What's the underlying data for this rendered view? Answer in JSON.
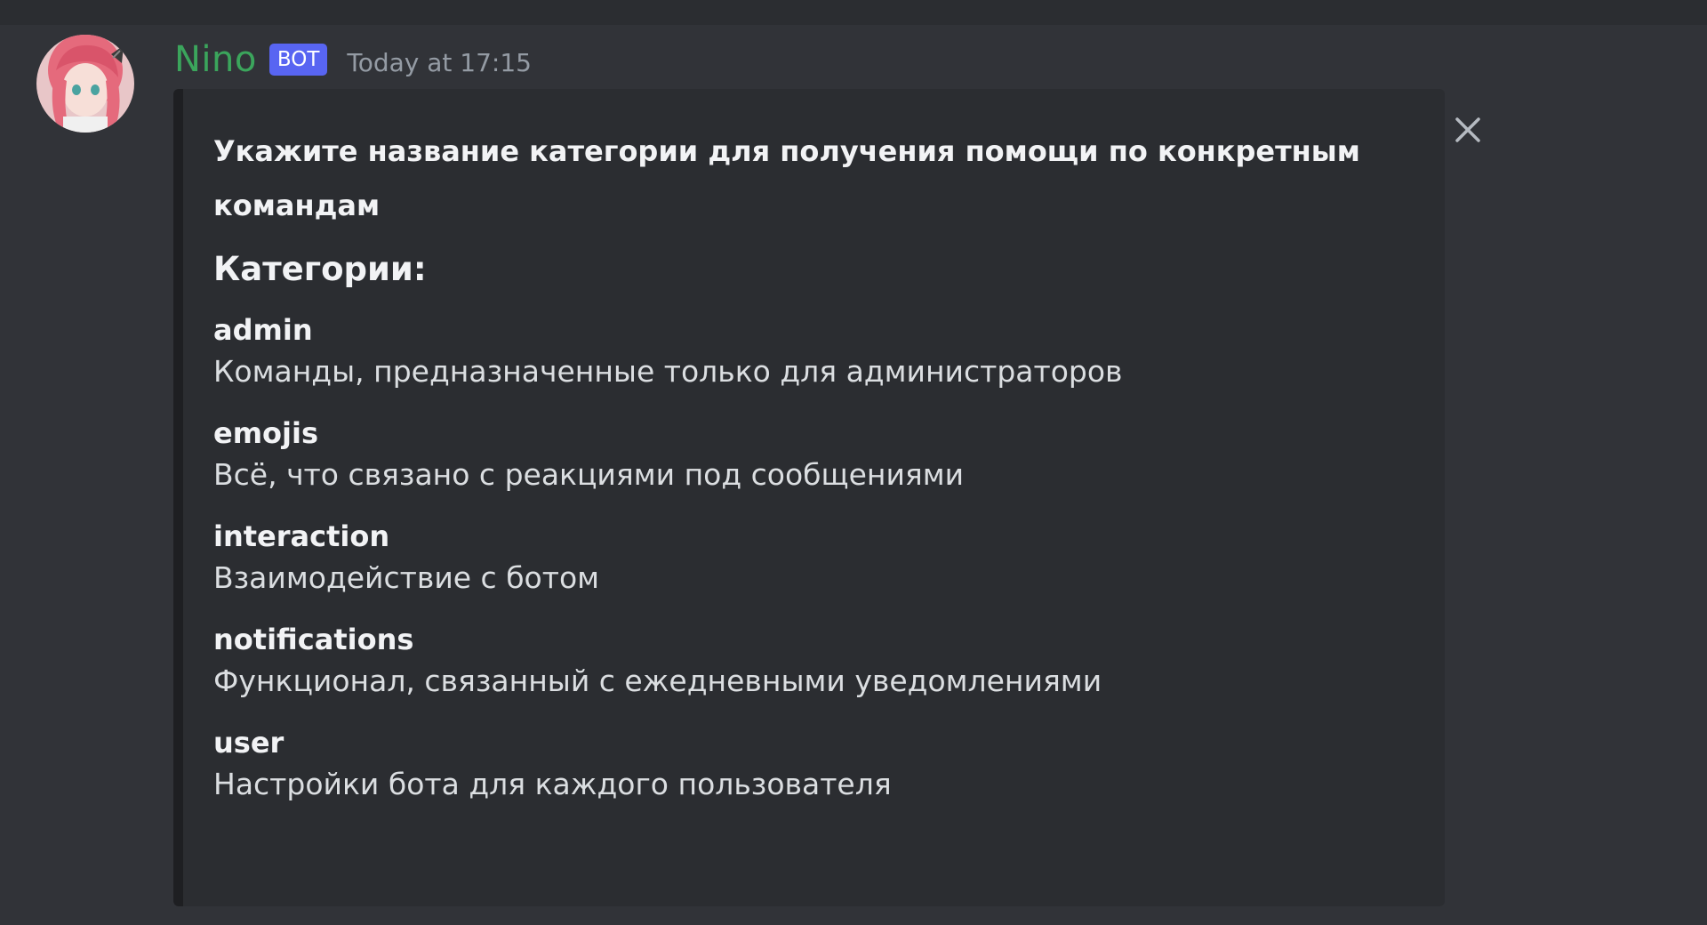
{
  "message": {
    "author": "Nino",
    "bot_tag": "BOT",
    "timestamp": "Today at 17:15"
  },
  "embed": {
    "description": "Укажите название категории для получения помощи по конкретным командам",
    "section_heading": "Категории:",
    "categories": [
      {
        "name": "admin",
        "description": "Команды, предназначенные только для администраторов"
      },
      {
        "name": "emojis",
        "description": "Всё, что связано с реакциями под сообщениями"
      },
      {
        "name": "interaction",
        "description": "Взаимодействие с ботом"
      },
      {
        "name": "notifications",
        "description": "Функционал, связанный с ежедневными уведомлениями"
      },
      {
        "name": "user",
        "description": "Настройки бота для каждого пользователя"
      }
    ]
  },
  "icons": {
    "close": "close-icon",
    "avatar": "avatar"
  },
  "colors": {
    "background": "#313338",
    "embed_background": "#2b2d31",
    "username": "#3ba55c",
    "bot_tag": "#5865f2",
    "timestamp": "#949ba4"
  }
}
